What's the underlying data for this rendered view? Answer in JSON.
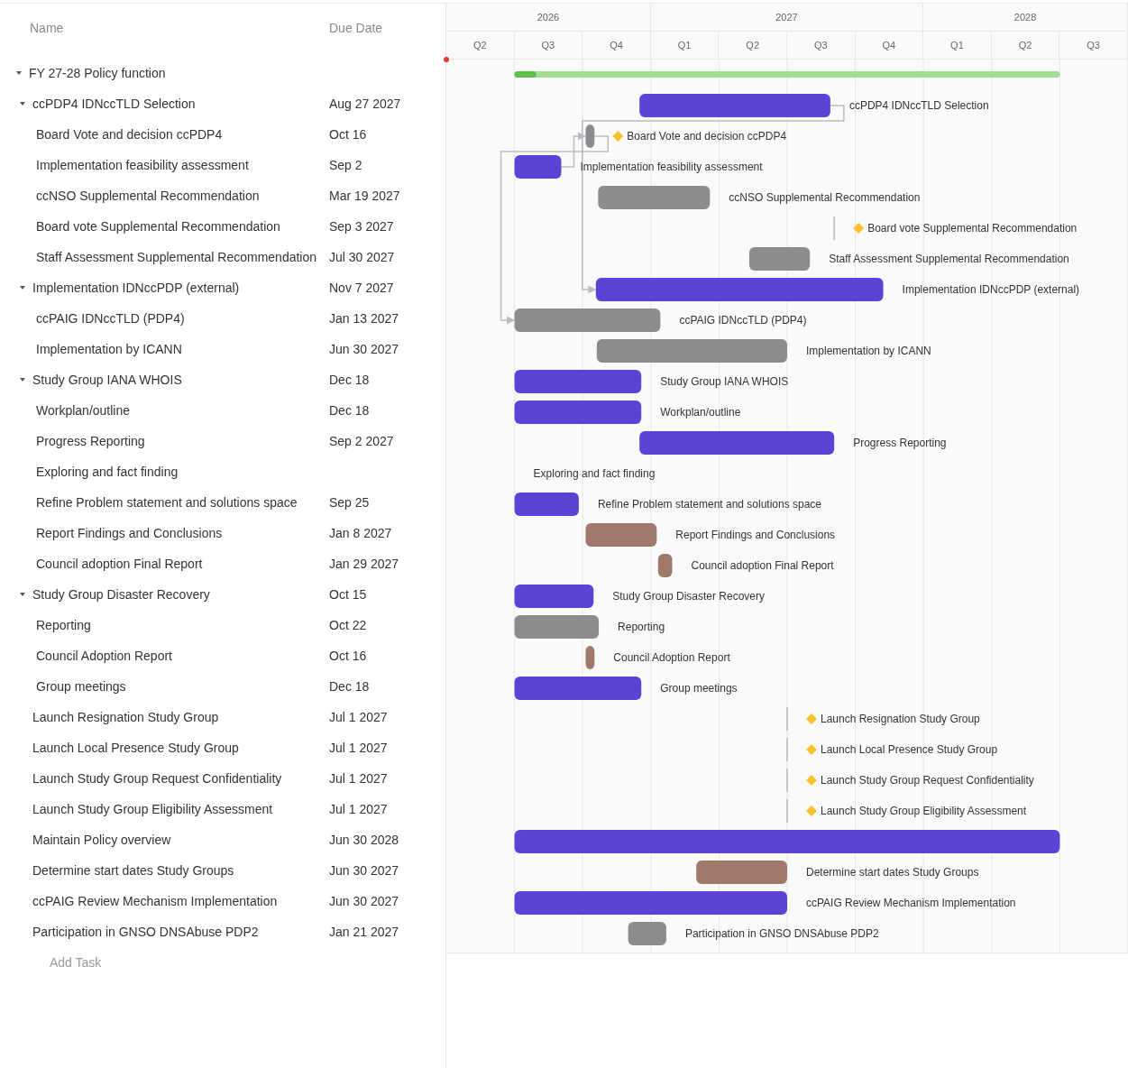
{
  "columns": [
    "Name",
    "Due Date"
  ],
  "timeline": {
    "years": [
      "2026",
      "2027",
      "2028"
    ],
    "quarters": [
      "Q2",
      "Q3",
      "Q4",
      "Q1",
      "Q2",
      "Q3",
      "Q4",
      "Q1",
      "Q2",
      "Q3"
    ]
  },
  "tasks": [
    {
      "name": "FY 27-28 Policy function",
      "kind": "summary",
      "expanded": true,
      "level": 0.04,
      "children": [
        {
          "name": "ccPDP4 IDNccTLD Selection",
          "due": "Aug 27 2027",
          "kind": "task",
          "color": "#5b43d6",
          "bar_label": "ccPDP4 IDNccTLD Selection",
          "expanded": true,
          "children": [
            {
              "name": "Board Vote and decision ccPDP4",
              "due": "Oct 16",
              "kind": "task",
              "color": "#8c8c8c",
              "diamond": true,
              "bar_label": "Board Vote and decision ccPDP4"
            },
            {
              "name": "Implementation feasibility assessment",
              "due": "Sep 2",
              "kind": "task",
              "color": "#5b43d6",
              "bar_label": "Implementation feasibility assessment"
            },
            {
              "name": "ccNSO Supplemental Recommendation",
              "due": "Mar 19 2027",
              "kind": "task",
              "color": "#8c8c8c",
              "bar_label": "ccNSO Supplemental Recommendation"
            },
            {
              "name": "Board vote Supplemental Recommendation",
              "due": "Sep 3 2027",
              "kind": "milestone",
              "bar_label": "Board vote Supplemental Recommendation"
            },
            {
              "name": "Staff Assessment Supplemental Recommendation",
              "due": "Jul 30 2027",
              "kind": "task",
              "color": "#8c8c8c",
              "bar_label": "Staff Assessment Supplemental Recommendation"
            }
          ]
        },
        {
          "name": "Implementation IDNccPDP (external)",
          "due": "Nov 7 2027",
          "kind": "task",
          "color": "#5b43d6",
          "bar_label": "Implementation IDNccPDP (external)",
          "expanded": true,
          "children": [
            {
              "name": "ccPAIG IDNccTLD (PDP4)",
              "due": "Jan 13 2027",
              "kind": "task",
              "color": "#8c8c8c",
              "bar_label": "ccPAIG IDNccTLD (PDP4)"
            },
            {
              "name": "Implementation by ICANN",
              "due": "Jun 30 2027",
              "kind": "task",
              "color": "#8c8c8c",
              "bar_label": "Implementation by ICANN"
            }
          ]
        },
        {
          "name": "Study Group IANA WHOIS",
          "due": "Dec 18",
          "kind": "task",
          "color": "#5b43d6",
          "bar_label": "Study Group IANA WHOIS",
          "expanded": true,
          "children": [
            {
              "name": "Workplan/outline",
              "due": "Dec 18",
              "kind": "task",
              "color": "#5b43d6",
              "bar_label": "Workplan/outline"
            },
            {
              "name": "Progress Reporting",
              "due": "Sep 2 2027",
              "kind": "task",
              "color": "#5b43d6",
              "bar_label": "Progress Reporting"
            },
            {
              "name": "Exploring and fact finding",
              "kind": "label",
              "bar_label": "Exploring and fact finding"
            },
            {
              "name": "Refine Problem statement and solutions space",
              "due": "Sep 25",
              "kind": "task",
              "color": "#5b43d6",
              "bar_label": "Refine Problem statement and solutions space"
            },
            {
              "name": "Report Findings and Conclusions",
              "due": "Jan 8 2027",
              "kind": "task",
              "color": "#a0796c",
              "bar_label": "Report Findings and Conclusions"
            },
            {
              "name": "Council adoption Final Report",
              "due": "Jan 29 2027",
              "kind": "task",
              "color": "#a0796c",
              "bar_label": "Council adoption Final Report"
            }
          ]
        },
        {
          "name": "Study Group Disaster Recovery",
          "due": "Oct 15",
          "kind": "task",
          "color": "#5b43d6",
          "bar_label": "Study Group Disaster Recovery",
          "expanded": true,
          "children": [
            {
              "name": "Reporting",
              "due": "Oct 22",
              "kind": "task",
              "color": "#8c8c8c",
              "bar_label": "Reporting"
            },
            {
              "name": "Council Adoption Report",
              "due": "Oct 16",
              "kind": "task",
              "color": "#a0796c",
              "bar_label": "Council Adoption Report"
            },
            {
              "name": "Group meetings",
              "due": "Dec 18",
              "kind": "task",
              "color": "#5b43d6",
              "bar_label": "Group meetings"
            }
          ]
        },
        {
          "name": "Launch Resignation Study Group",
          "due": "Jul 1 2027",
          "kind": "milestone",
          "bar_label": "Launch Resignation Study Group"
        },
        {
          "name": "Launch Local Presence Study Group",
          "due": "Jul 1 2027",
          "kind": "milestone",
          "bar_label": "Launch Local Presence Study Group"
        },
        {
          "name": "Launch Study Group Request Confidentiality",
          "due": "Jul 1 2027",
          "kind": "milestone",
          "bar_label": "Launch Study Group Request Confidentiality"
        },
        {
          "name": "Launch Study Group Eligibility Assessment",
          "due": "Jul 1 2027",
          "kind": "milestone",
          "bar_label": "Launch Study Group Eligibility Assessment"
        },
        {
          "name": "Maintain Policy overview",
          "due": "Jun 30 2028",
          "kind": "task",
          "color": "#5b43d6"
        },
        {
          "name": "Determine start dates Study Groups",
          "due": "Jun 30 2027",
          "kind": "task",
          "color": "#a0796c",
          "bar_label": "Determine start dates Study Groups"
        },
        {
          "name": "ccPAIG Review Mechanism Implementation",
          "due": "Jun 30 2027",
          "kind": "task",
          "color": "#5b43d6",
          "bar_label": "ccPAIG Review Mechanism Implementation"
        },
        {
          "name": "Participation in GNSO DNSAbuse PDP2",
          "due": "Jan 21 2027",
          "kind": "task",
          "color": "#8c8c8c",
          "bar_label": "Participation in GNSO DNSAbuse PDP2"
        }
      ]
    }
  ],
  "add_task": "Add Task"
}
